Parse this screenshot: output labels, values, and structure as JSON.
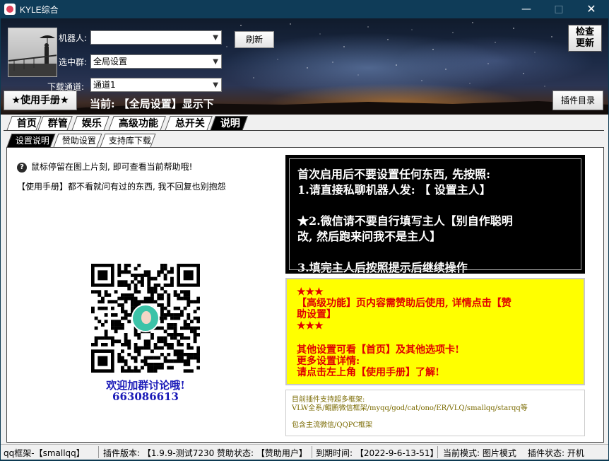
{
  "window": {
    "title": "KYLE综合",
    "minimize": "—",
    "maximize": "□",
    "close": "✕"
  },
  "header": {
    "robot_label": "机器人:",
    "robot_value": "",
    "group_label": "选中群:",
    "group_value": "全局设置",
    "channel_label": "下载通道:",
    "channel_value": "通道1",
    "refresh_button": "刷新",
    "manual_button": "★使用手册★",
    "current_text": "当前: 【全局设置】显示下",
    "check_update_button_line1": "检查",
    "check_update_button_line2": "更新",
    "plugin_dir_button": "插件目录"
  },
  "main_tabs": [
    "首页",
    "群管",
    "娱乐",
    "高级功能",
    "总开关",
    "说明"
  ],
  "main_tabs_active": "说明",
  "sub_tabs": [
    "设置说明",
    "赞助设置",
    "支持库下载"
  ],
  "sub_tabs_active": "设置说明",
  "help": {
    "hover_tip": "鼠标停留在图上片刻, 即可查看当前帮助哦!",
    "manual_note": "【使用手册】都不看就问有过的东西, 我不回复也别抱怨",
    "qr_caption_line1": "欢迎加群讨论哦!",
    "qr_caption_line2": "663086613"
  },
  "black_box": {
    "line1": "首次启用后不要设置任何东西, 先按照:",
    "line2": "1.请直接私聊机器人发: 【 设置主人】",
    "line3": "★2.微信请不要自行填写主人【别自作聪明",
    "line4": "改, 然后跑来问我不是主人】",
    "line5": "3.填完主人后按照提示后继续操作"
  },
  "yellow_box": {
    "stars1": "★★★",
    "line1": "【高级功能】页内容需赞助后使用, 详情点击【赞",
    "line2": "助设置】",
    "stars2": "★★★",
    "line3": "其他设置可看【首页】及其他选项卡!",
    "line4": "更多设置详情:",
    "line5": "请点击左上角【使用手册】了解!"
  },
  "info_box": {
    "line1": "目前插件支持超多框架:",
    "line2": "VLW全系/鲲鹏微信框架/myqq/god/cat/ono/ER/VLQ/smallqq/starqq等",
    "line3": "包含主流微信/QQPC框架"
  },
  "status": {
    "frame": "qq框架-【smallqq】",
    "version": "插件版本: 【1.9.9-测试7230",
    "sponsor": "赞助状态: 【赞助用户】",
    "expire": "到期时间: 【2022-9-6-13-51】",
    "mode": "当前模式: 图片模式",
    "plugin_state": "插件状态: 开机"
  },
  "colors": {
    "titlebar": "#0f3c58",
    "black_box_text": "#ffffff",
    "yellow_box_bg": "#ffff00",
    "yellow_box_text": "#e00000",
    "qr_caption": "#1a1ab8",
    "info_text": "#7a6a00"
  }
}
